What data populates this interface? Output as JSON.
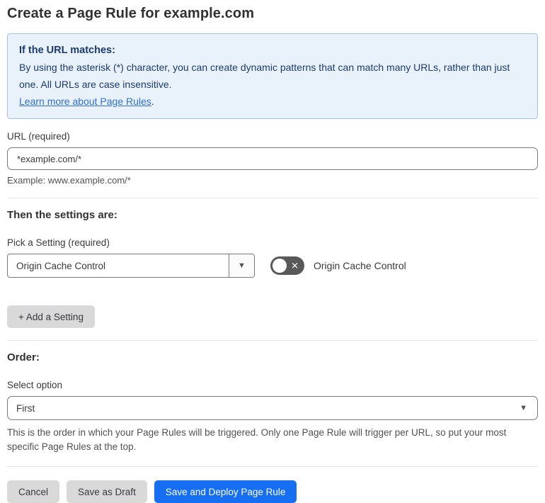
{
  "page": {
    "title": "Create a Page Rule for example.com"
  },
  "info_box": {
    "heading": "If the URL matches:",
    "body": "By using the asterisk (*) character, you can create dynamic patterns that can match many URLs, rather than just one. All URLs are case insensitive.",
    "link_text": "Learn more about Page Rules",
    "link_suffix": "."
  },
  "url_field": {
    "label": "URL (required)",
    "value": "*example.com/*",
    "helper": "Example: www.example.com/*"
  },
  "settings_section": {
    "heading": "Then the settings are:",
    "setting_label": "Pick a Setting (required)",
    "setting_selected": "Origin Cache Control",
    "toggle_state": "off",
    "toggle_label": "Origin Cache Control",
    "add_setting_button": "+ Add a Setting"
  },
  "order_section": {
    "heading": "Order:",
    "label": "Select option",
    "selected": "First",
    "helper": "This is the order in which your Page Rules will be triggered. Only one Page Rule will trigger per URL, so put your most specific Page Rules at the top."
  },
  "footer": {
    "cancel_label": "Cancel",
    "save_draft_label": "Save as Draft",
    "save_deploy_label": "Save and Deploy Page Rule"
  },
  "icons": {
    "chevron_down": "▼",
    "toggle_off_glyph": "✕"
  },
  "colors": {
    "accent_blue": "#166ef3",
    "info_background": "#e9f2fb",
    "info_border": "#9ec4ea",
    "info_text": "#1b3a70",
    "link_blue": "#2f6fd6",
    "toggle_off_background": "#595959",
    "button_gray": "#d9d9d9",
    "divider_gray": "#e4e4e4"
  }
}
